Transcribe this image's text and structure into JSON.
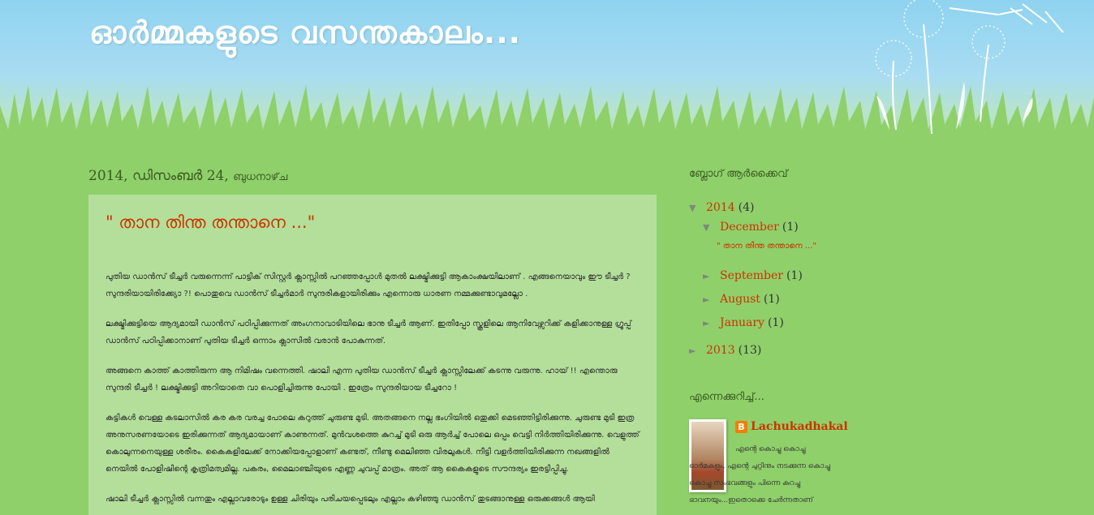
{
  "blog": {
    "title": "ഓർമ്മകളുടെ വസന്തകാലം..."
  },
  "date_header": {
    "date": "2014, ഡിസംബർ 24,",
    "weekday": "ബുധനാഴ്‌ച"
  },
  "post": {
    "title": "\" താന തിന്ത തന്താനെ ...\"",
    "paragraphs": [
      "പുതിയ ഡാൻസ് ടീച്ചർ വരുന്നെന്ന് പാട്ടിക് സിസ്റ്റർ ക്ലാസ്സിൽ പറഞ്ഞപ്പോൾ മുതൽ ലക്ഷ്മിക്കുട്ടി ആകാംക്ഷയിലാണ് . എങ്ങനെയാവും ഈ ടീച്ചർ ? സുന്ദരിയായിരിക്ക്യോ ?! പൊതുവെ ഡാൻസ് ടീച്ചർമാർ സുന്ദരികളായിരിക്കും എന്നൊരു ധാരണ നമ്മക്കുണ്ടാവുമല്ലോ .",
      "ലക്ഷ്മിക്കുട്ടിയെ ആദ്യമായി ഡാൻസ് പഠിപ്പിക്കുന്നത് അംഗനാവാടിയിലെ ഭാനു ടീച്ചർ ആണ്. ഇതിപ്പോ സ്കൂളിലെ ആനിവേഴ്സറിക്ക് കളിക്കാനുള്ള ഗ്രൂപ്പ് ഡാൻസ് പഠിപ്പിക്കാനാണ് പുതിയ ടീച്ചർ ഒന്നാം ക്ലാസിൽ വരാൻ പോകുന്നത്.",
      "അങ്ങനെ കാത്ത് കാത്തിരുന്ന ആ നിമിഷം വന്നെത്തി. ഷാലി എന്ന പുതിയ ഡാൻസ് ടീച്ചർ ക്ലാസ്സിലേക്ക് കടന്നു വരുന്നു. ഹായ് !! എന്തൊരു സുന്ദരി ടീച്ചർ ! ലക്ഷ്മിക്കുട്ടി അറിയാതെ വാ പൊളിച്ചിരുന്നു പോയി . ഇത്രേം സുന്ദരിയായ ടീച്ചറോ !",
      "കട്ടികൾ വെള്ള കടലാസിൽ കര കര വരച്ച പോലെ കറുത്ത് ചുരുണ്ട മുടി. അതങ്ങനെ നല്ല ഭംഗിയിൽ ഒതുക്കി മെടഞ്ഞിട്ടിരിക്കുന്നു. ചുരുണ്ട മുടി ഇത്ര അനുസരണയോടെ ഇരിക്കുന്നത് ആദ്യമായാണ് കാണുന്നത്. മുൻവശത്തെ കുറച്ച് മുടി ഒരു ആർച്ച് പോലെ ഒപ്പം വെട്ടി നിർത്തിയിരിക്കുന്നു. വെളുത്ത് കൊലുന്നനെയുള്ള ശരീരം. കൈകളിലേക്ക് നോക്കിയപ്പോളാണ് കണ്ടത്, നീണ്ടു മെലിഞ്ഞ വിരലുകൾ. നീട്ടി വളർത്തിയിരിക്കുന്ന നഖങ്ങളിൽ നെയിൽ പോളിഷിന്റെ കൃത്രിമത്വമില്ല. പകരം, മൈലാഞ്ചിയുടെ എണ്ണ ചുവപ്പ് മാത്രം. അത് ആ കൈകളുടെ സൗന്ദര്യം ഇരട്ടിപ്പിച്ചു.",
      "ഷാലി ടീച്ചർ ക്ലാസ്സിൽ വന്നതും എല്ലാവരോടും ഉള്ള ചിരിയും പരിചയപ്പെടലും എല്ലാം കഴിഞ്ഞു ഡാൻസ് തുടങ്ങാനുള്ള ഒരുക്കങ്ങൾ ആയി"
    ]
  },
  "sidebar": {
    "archive_title": "ബ്ലോഗ് ആർക്കൈവ്",
    "archive": {
      "y2014": {
        "label": "2014",
        "count": "(4)",
        "toggle": "▼"
      },
      "dec": {
        "label": "December",
        "count": "(1)",
        "toggle": "▼"
      },
      "dec_post": "\" താന തിന്ത തന്താനെ ...\"",
      "sep": {
        "label": "September",
        "count": "(1)",
        "toggle": "►"
      },
      "aug": {
        "label": "August",
        "count": "(1)",
        "toggle": "►"
      },
      "jan": {
        "label": "January",
        "count": "(1)",
        "toggle": "►"
      },
      "y2013": {
        "label": "2013",
        "count": "(13)",
        "toggle": "►"
      }
    },
    "about_title": "എന്നെക്കുറിച്ച്...",
    "profile": {
      "name": "Lachukadhakal",
      "blogger_letter": "B",
      "description": "എന്റെ കൊച്ചു കൊച്ചു ഓർമകളും, എന്റെ ചുറ്റിനും നടക്കുന്ന കൊച്ചു കൊച്ചു സംഭവങ്ങളും പിന്നെ കുറച്ചു ഭാവനയും...ഇതൊക്കെ ചേർന്നതാണ്"
    }
  }
}
